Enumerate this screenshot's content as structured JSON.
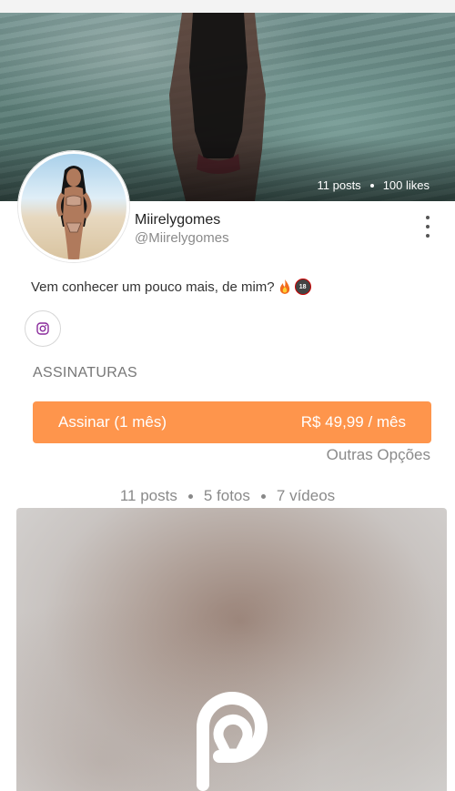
{
  "profile": {
    "display_name": "Miirelygomes",
    "handle": "@Miirelygomes",
    "bio": "Vem conhecer um pouco mais, de mim?",
    "bio_emoji_18": "18"
  },
  "cover": {
    "posts": "11 posts",
    "likes": "100 likes"
  },
  "social": {
    "icon": "instagram-icon"
  },
  "subscriptions": {
    "title": "ASSINATURAS",
    "plan_label": "Assinar (1 mês)",
    "plan_price": "R$ 49,99 / mês",
    "other_options": "Outras Opções",
    "accent_color": "#fe954c"
  },
  "content_counts": {
    "posts": "11 posts",
    "photos": "5 fotos",
    "videos": "7 vídeos"
  },
  "locked_post": {
    "icon": "privacy-logo-icon"
  }
}
